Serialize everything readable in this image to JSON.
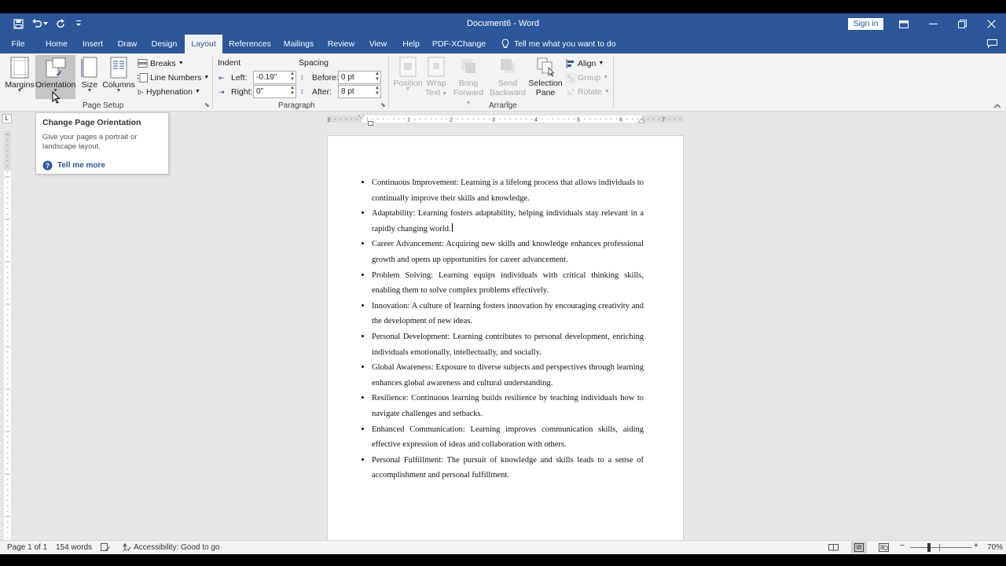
{
  "titlebar": {
    "title": "Document6  -  Word",
    "sign_in": "Sign in"
  },
  "tabs": [
    {
      "label": "File"
    },
    {
      "label": "Home"
    },
    {
      "label": "Insert"
    },
    {
      "label": "Draw"
    },
    {
      "label": "Design"
    },
    {
      "label": "Layout"
    },
    {
      "label": "References"
    },
    {
      "label": "Mailings"
    },
    {
      "label": "Review"
    },
    {
      "label": "View"
    },
    {
      "label": "Help"
    },
    {
      "label": "PDF-XChange"
    }
  ],
  "tell_me": "Tell me what you want to do",
  "ribbon": {
    "page_setup": {
      "label": "Page Setup",
      "margins": "Margins",
      "orientation": "Orientation",
      "size": "Size",
      "columns": "Columns",
      "breaks": "Breaks",
      "line_numbers": "Line Numbers",
      "hyphenation": "Hyphenation"
    },
    "paragraph": {
      "label": "Paragraph",
      "indent": "Indent",
      "spacing": "Spacing",
      "left_label": "Left:",
      "left_value": "-0.19\"",
      "right_label": "Right:",
      "right_value": "0\"",
      "before_label": "Before:",
      "before_value": "0 pt",
      "after_label": "After:",
      "after_value": "8 pt"
    },
    "arrange": {
      "label": "Arrange",
      "position": "Position",
      "wrap_text_1": "Wrap",
      "wrap_text_2": "Text",
      "bring_forward_1": "Bring",
      "bring_forward_2": "Forward",
      "send_backward_1": "Send",
      "send_backward_2": "Backward",
      "selection_pane_1": "Selection",
      "selection_pane_2": "Pane",
      "align": "Align",
      "group": "Group",
      "rotate": "Rotate"
    }
  },
  "tooltip": {
    "title": "Change Page Orientation",
    "body": "Give your pages a portrait or landscape layout.",
    "more": "Tell me more"
  },
  "ruler": {
    "numbers": [
      "1",
      "1",
      "2",
      "3",
      "4",
      "5",
      "6",
      "7"
    ]
  },
  "document": {
    "items": [
      "Continuous Improvement: Learning is a lifelong process that allows individuals to continually improve their skills and knowledge.",
      "Adaptability: Learning fosters adaptability, helping individuals stay relevant in a rapidly changing world.",
      "Career Advancement: Acquiring new skills and knowledge enhances professional growth and opens up opportunities for career advancement.",
      "Problem Solving: Learning equips individuals with critical thinking skills, enabling them to solve complex problems effectively.",
      "Innovation: A culture of learning fosters innovation by encouraging creativity and the development of new ideas.",
      "Personal Development: Learning contributes to personal development, enriching individuals emotionally, intellectually, and socially.",
      "Global Awareness: Exposure to diverse subjects and perspectives through learning enhances global awareness and cultural understanding.",
      "Resilience: Continuous learning builds resilience by teaching individuals how to navigate challenges and setbacks.",
      "Enhanced Communication: Learning improves communication skills, aiding effective expression of ideas and collaboration with others.",
      "Personal Fulfillment: The pursuit of knowledge and skills leads to a sense of accomplishment and personal fulfillment."
    ]
  },
  "statusbar": {
    "page": "Page 1 of 1",
    "words": "154 words",
    "accessibility": "Accessibility: Good to go",
    "zoom": "70%"
  },
  "colors": {
    "brand": "#2b579a",
    "ribbon_bg": "#f3f3f3",
    "canvas_bg": "#e6e6e6"
  }
}
